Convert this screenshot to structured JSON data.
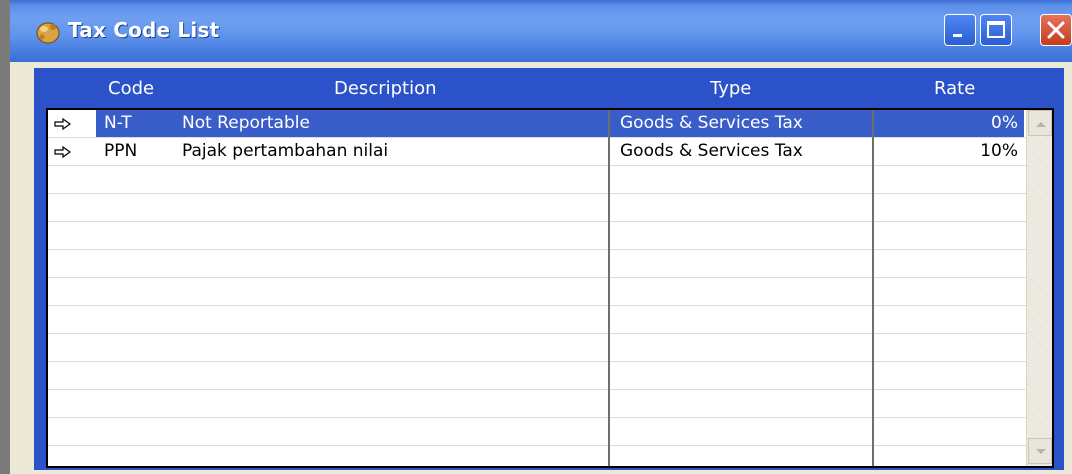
{
  "window": {
    "title": "Tax Code List",
    "icon": "tax-icon"
  },
  "columns": {
    "code": "Code",
    "description": "Description",
    "type": "Type",
    "rate": "Rate"
  },
  "rows": [
    {
      "code": "N-T",
      "description": "Not Reportable",
      "type": "Goods & Services Tax",
      "rate": "0%",
      "selected": true
    },
    {
      "code": "PPN",
      "description": "Pajak pertambahan nilai",
      "type": "Goods & Services Tax",
      "rate": "10%",
      "selected": false
    }
  ],
  "colors": {
    "titlebar": "#6296ee",
    "header": "#2b52c8",
    "selection": "#3a5ec9"
  }
}
